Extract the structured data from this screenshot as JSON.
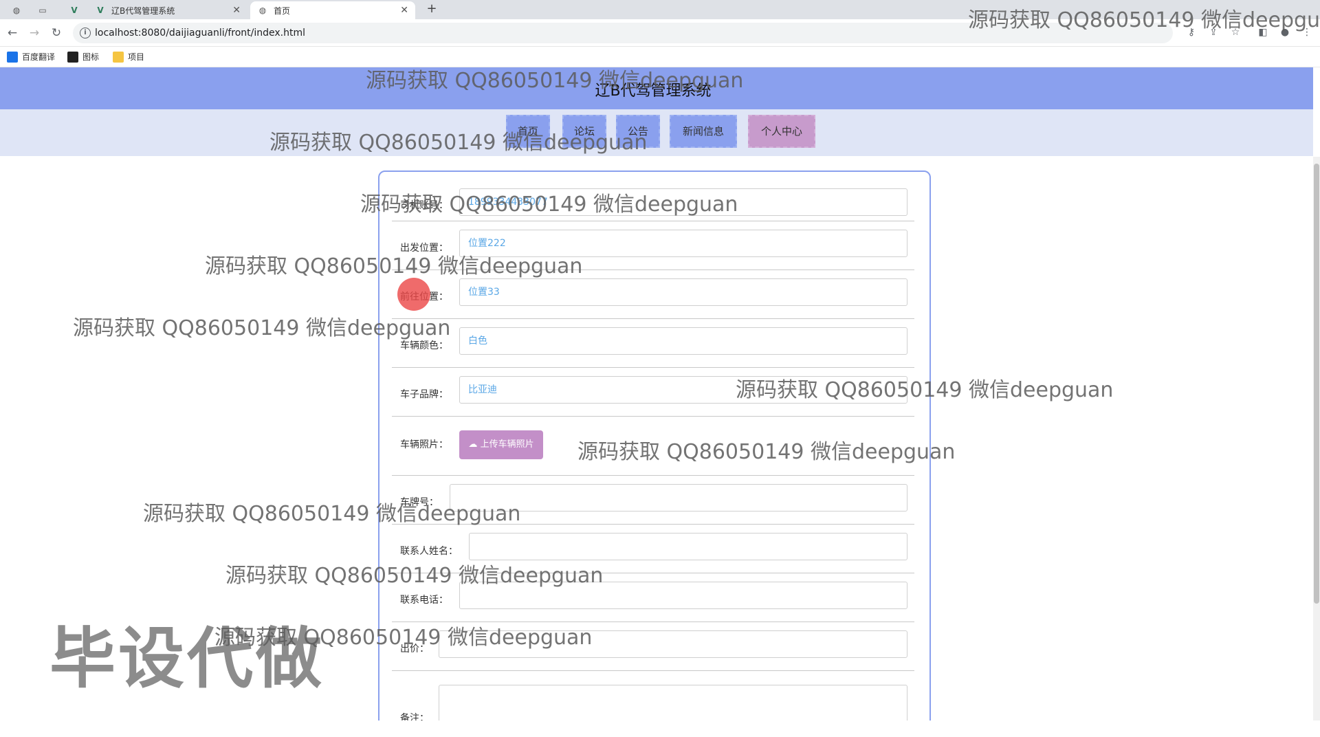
{
  "browser": {
    "tabs": [
      {
        "label": "",
        "icon": "globe-icon"
      },
      {
        "label": "",
        "icon": "blank-page-icon"
      },
      {
        "label": "",
        "icon": "vue-icon"
      },
      {
        "label": "辽B代驾管理系统",
        "icon": "vue-icon"
      },
      {
        "label": "首页",
        "icon": "globe-icon",
        "active": true
      }
    ],
    "url": "localhost:8080/daijiaguanli/front/index.html",
    "bookmarks": [
      {
        "label": "百度翻译",
        "color": "#1a73e8"
      },
      {
        "label": "图标",
        "color": "#222222"
      },
      {
        "label": "项目",
        "color": "#f5c542"
      }
    ]
  },
  "site": {
    "title": "辽B代驾管理系统",
    "nav": [
      {
        "label": "首页"
      },
      {
        "label": "论坛"
      },
      {
        "label": "公告"
      },
      {
        "label": "新闻信息"
      },
      {
        "label": "个人中心",
        "active": true
      }
    ]
  },
  "form": {
    "fields": [
      {
        "label": "司机账号：",
        "value": "1899334433077"
      },
      {
        "label": "出发位置：",
        "value": "位置222"
      },
      {
        "label": "前往位置：",
        "value": "位置33"
      },
      {
        "label": "车辆颜色：",
        "value": "白色"
      },
      {
        "label": "车子品牌：",
        "value": "比亚迪"
      },
      {
        "label": "车辆照片：",
        "button": "上传车辆照片"
      },
      {
        "label": "车牌号：",
        "value": ""
      },
      {
        "label": "联系人姓名：",
        "value": ""
      },
      {
        "label": "联系电话：",
        "value": ""
      },
      {
        "label": "出价：",
        "value": ""
      },
      {
        "label": "备注：",
        "value": ""
      }
    ]
  },
  "overlays": {
    "watermark_text": "源码获取 QQ86050149 微信deepguan",
    "big_watermark": "毕设代做"
  },
  "colors": {
    "header": "#8aa0ee",
    "nav_active": "#c79bcc",
    "input_text": "#5aa7e6"
  }
}
